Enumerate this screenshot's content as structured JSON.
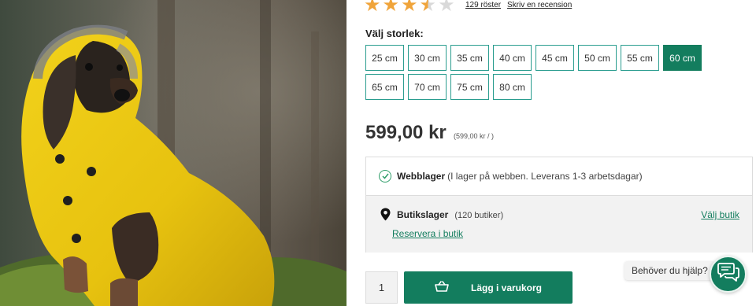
{
  "product_image": {
    "alt": ""
  },
  "rating": {
    "stars": 3.5,
    "max_stars": 5,
    "votes_label": "129 röster",
    "review_link": "Skriv en recension",
    "star_color": "#f0a43a"
  },
  "size_selector": {
    "label": "Välj storlek:",
    "selected": "60 cm",
    "options": [
      "25 cm",
      "30 cm",
      "35 cm",
      "40 cm",
      "45 cm",
      "50 cm",
      "55 cm",
      "60 cm",
      "65 cm",
      "70 cm",
      "75 cm",
      "80 cm"
    ]
  },
  "price": {
    "main": "599,00 kr",
    "unit": "(599,00 kr / )"
  },
  "stock": {
    "web_title": "Webblager",
    "web_desc": "(I lager på webben. Leverans 1-3 arbetsdagar)",
    "store_title": "Butikslager",
    "store_count": "(120 butiker)",
    "reserve_link": "Reservera i butik",
    "choose_store": "Välj butik"
  },
  "cart": {
    "quantity": "1",
    "button_label": "Lägg i varukorg"
  },
  "help": {
    "bubble_text": "Behöver du hjälp?"
  },
  "colors": {
    "brand_green": "#137d5e",
    "size_border": "#2a9d8f",
    "check_green": "#2f9e6a"
  }
}
